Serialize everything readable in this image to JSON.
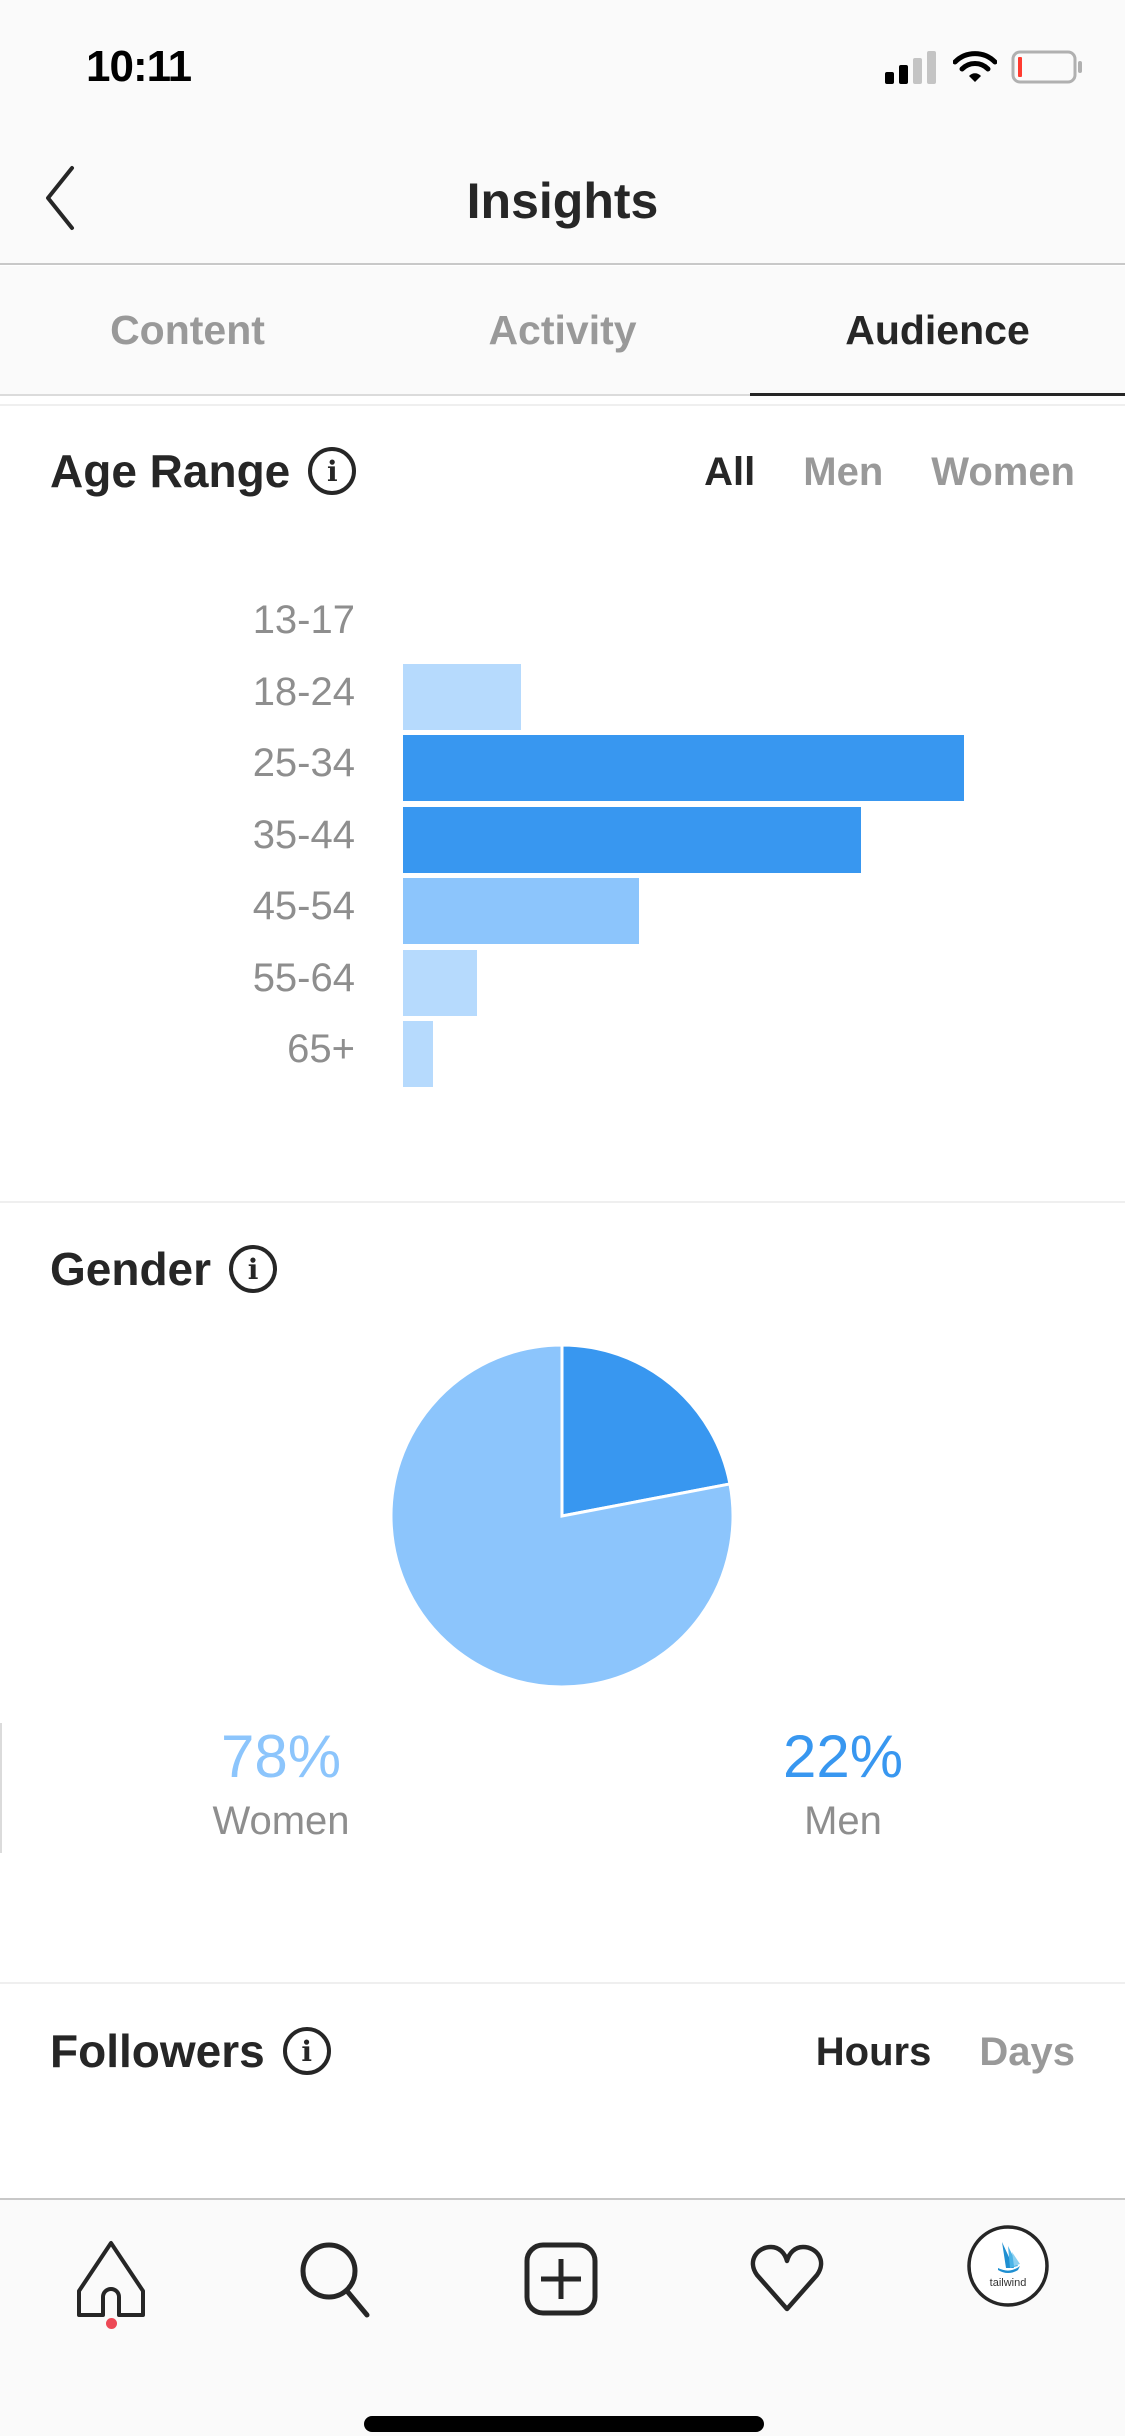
{
  "status_bar": {
    "time": "10:11",
    "icons": [
      "signal-icon",
      "wifi-icon",
      "battery-low-icon"
    ]
  },
  "nav": {
    "title": "Insights",
    "back_icon": "chevron-left-icon"
  },
  "tabs": [
    {
      "label": "Content",
      "active": false
    },
    {
      "label": "Activity",
      "active": false
    },
    {
      "label": "Audience",
      "active": true
    }
  ],
  "age_range": {
    "title": "Age Range",
    "filters": [
      {
        "label": "All",
        "active": true
      },
      {
        "label": "Men",
        "active": false
      },
      {
        "label": "Women",
        "active": false
      }
    ]
  },
  "gender": {
    "title": "Gender",
    "women": {
      "pct": "78%",
      "label": "Women"
    },
    "men": {
      "pct": "22%",
      "label": "Men"
    }
  },
  "followers": {
    "title": "Followers",
    "filters": [
      {
        "label": "Hours",
        "active": true
      },
      {
        "label": "Days",
        "active": false
      }
    ]
  },
  "bottom_nav": {
    "items": [
      "home-icon",
      "search-icon",
      "new-post-icon",
      "activity-heart-icon",
      "profile-avatar"
    ],
    "avatar_text": "tailwind"
  },
  "colors": {
    "dark_blue": "#3897f0",
    "mid_blue": "#8cc5fc",
    "light_blue": "#b6dafd",
    "notification": "#ed4956"
  },
  "chart_data": [
    {
      "type": "bar",
      "orientation": "horizontal",
      "title": "Age Range",
      "categories": [
        "13-17",
        "18-24",
        "25-34",
        "35-44",
        "45-54",
        "55-64",
        "65+"
      ],
      "values": [
        0,
        8,
        38,
        31,
        16,
        5,
        2
      ],
      "unit": "% (approximate, read from bar lengths)",
      "bar_colors": [
        "#b6dafd",
        "#b6dafd",
        "#3897f0",
        "#3897f0",
        "#8cc5fc",
        "#b6dafd",
        "#b6dafd"
      ],
      "xlabel": "",
      "ylabel": ""
    },
    {
      "type": "pie",
      "title": "Gender",
      "categories": [
        "Men",
        "Women"
      ],
      "values": [
        22,
        78
      ],
      "colors": [
        "#3897f0",
        "#8cc5fc"
      ]
    }
  ]
}
